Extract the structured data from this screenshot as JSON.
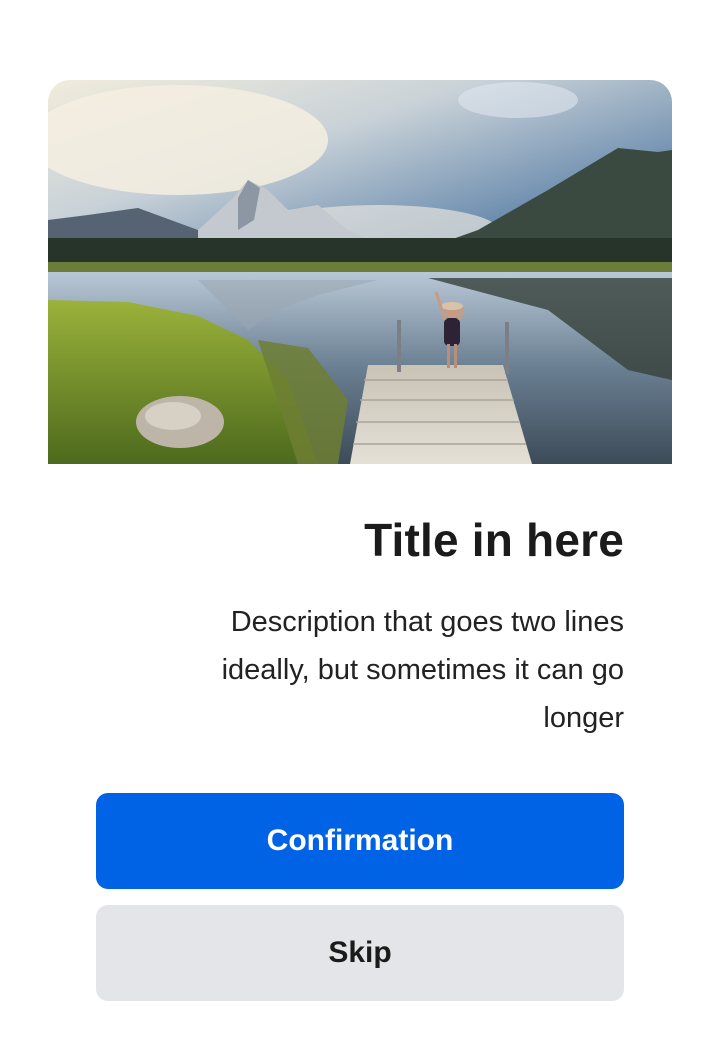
{
  "hero": {
    "image_subject": "mountain lake with wooden dock and person",
    "icon": "landscape-photo"
  },
  "content": {
    "title": "Title in here",
    "description": "Description that goes two lines ideally, but sometimes it can go longer"
  },
  "actions": {
    "primary_label": "Confirmation",
    "secondary_label": "Skip"
  },
  "colors": {
    "primary": "#0063e5",
    "secondary": "#e3e5e8",
    "text": "#1b1b1b",
    "background": "#ffffff"
  }
}
